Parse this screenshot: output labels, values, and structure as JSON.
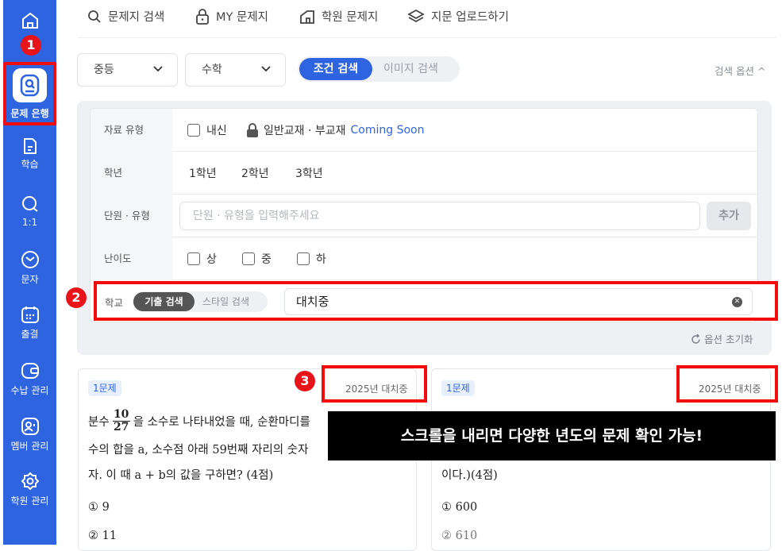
{
  "sidebar": {
    "items": [
      {
        "label": "",
        "icon": "home-icon"
      },
      {
        "label": "문제 은행",
        "icon": "question-bank-icon"
      },
      {
        "label": "학습",
        "icon": "study-icon"
      },
      {
        "label": "1:1",
        "icon": "chat-icon"
      },
      {
        "label": "문자",
        "icon": "message-icon"
      },
      {
        "label": "출결",
        "icon": "calendar-icon"
      },
      {
        "label": "수납 관리",
        "icon": "wallet-icon"
      },
      {
        "label": "멤버 관리",
        "icon": "member-icon"
      },
      {
        "label": "학원 관리",
        "icon": "gear-icon"
      }
    ]
  },
  "annotations": {
    "one": "1",
    "two": "2",
    "three": "3"
  },
  "topnav": {
    "search": "문제지 검색",
    "my": "MY 문제지",
    "academy": "학원 문제지",
    "upload": "지문 업로드하기"
  },
  "filters": {
    "level": "중등",
    "subject": "수학",
    "mode_on": "조건 검색",
    "mode_off": "이미지 검색",
    "search_options": "검색 옵션 ^"
  },
  "form": {
    "type_label": "자료 유형",
    "type_option": "내신",
    "type_locked": "일반교재 · 부교재",
    "coming_soon": "Coming Soon",
    "grade_label": "학년",
    "grades": [
      "1학년",
      "2학년",
      "3학년"
    ],
    "unit_label": "단원 · 유형",
    "unit_placeholder": "단원 · 유형을 입력해주세요",
    "add": "추가",
    "difficulty_label": "난이도",
    "difficulties": [
      "상",
      "중",
      "하"
    ],
    "school_label": "학교",
    "school_mode_on": "기출 검색",
    "school_mode_off": "스타일 검색",
    "school_value": "대치중",
    "reset": "옵션 초기화"
  },
  "questions": [
    {
      "tag": "1문제",
      "year": "2025년 대치중",
      "line1_pre": "분수",
      "frac_num": "10",
      "frac_den": "27",
      "line1_post": "을 소수로 나타내었을 때, 순환마디를",
      "line2": "수의 합을 a, 소수점 아래 59번째 자리의 숫자",
      "line3": "자. 이 때 a + b의 값을 구하면? (4점)",
      "opt1": "① 9",
      "opt2": "② 11"
    },
    {
      "tag": "1문제",
      "year": "2025년 대치중",
      "line3": "이다.)(4점)",
      "opt1": "① 600",
      "opt2": "② 610"
    }
  ],
  "overlay_text": "스크롤을 내리면 다양한 년도의 문제 확인 가능!",
  "colors": {
    "brand": "#2f64e0",
    "highlight": "#f20d0d",
    "annotation": "#e8141a"
  }
}
